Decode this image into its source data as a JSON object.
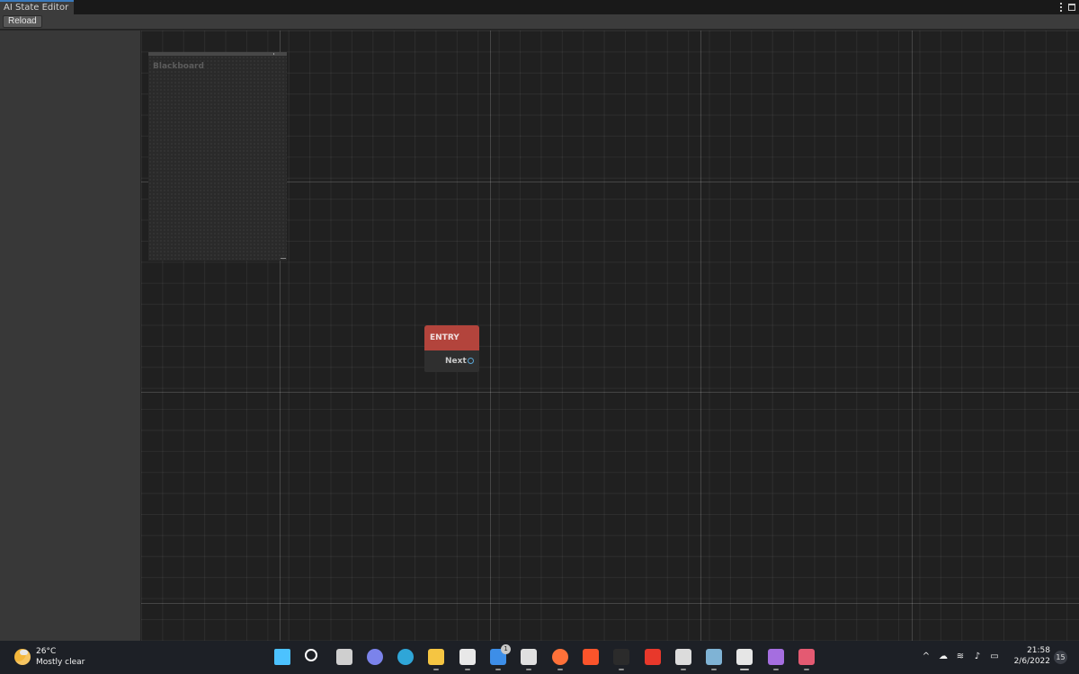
{
  "window": {
    "tab_title": "AI State Editor"
  },
  "toolbar": {
    "reload_label": "Reload"
  },
  "graph": {
    "blackboard_title": "Blackboard",
    "entry_node": {
      "title": "ENTRY",
      "output_port_label": "Next"
    }
  },
  "taskbar": {
    "weather": {
      "temperature": "26°C",
      "description": "Mostly clear"
    },
    "apps": [
      {
        "name": "start-icon",
        "color": "#4cc2ff"
      },
      {
        "name": "search-icon",
        "color": "#ffffff"
      },
      {
        "name": "task-view-icon",
        "color": "#cfcfcf"
      },
      {
        "name": "teams-chat-icon",
        "color": "#7b83eb"
      },
      {
        "name": "edge-icon",
        "color": "#2fa6d8"
      },
      {
        "name": "file-explorer-icon",
        "color": "#f5c542"
      },
      {
        "name": "store-icon",
        "color": "#e8e8e8"
      },
      {
        "name": "mail-icon",
        "color": "#3d8ee8",
        "badge": "1"
      },
      {
        "name": "unity-hub-icon",
        "color": "#e0e0e0"
      },
      {
        "name": "firefox-icon",
        "color": "#ff7139"
      },
      {
        "name": "brave-icon",
        "color": "#fb542b"
      },
      {
        "name": "terminal-icon",
        "color": "#2b2b2b"
      },
      {
        "name": "wps-office-icon",
        "color": "#e8382b"
      },
      {
        "name": "unity-icon",
        "color": "#dcdcdc"
      },
      {
        "name": "photos-icon",
        "color": "#7fb3d5"
      },
      {
        "name": "unity-editor-icon",
        "color": "#e6e6e6"
      },
      {
        "name": "visual-studio-icon",
        "color": "#a56ee0"
      },
      {
        "name": "snipping-tool-icon",
        "color": "#e45a72"
      }
    ],
    "tray": {
      "icons": [
        "chevron-up-icon",
        "onedrive-icon",
        "wifi-icon",
        "volume-icon",
        "battery-icon"
      ],
      "time": "21:58",
      "date": "2/6/2022",
      "notification_count": "15"
    }
  }
}
